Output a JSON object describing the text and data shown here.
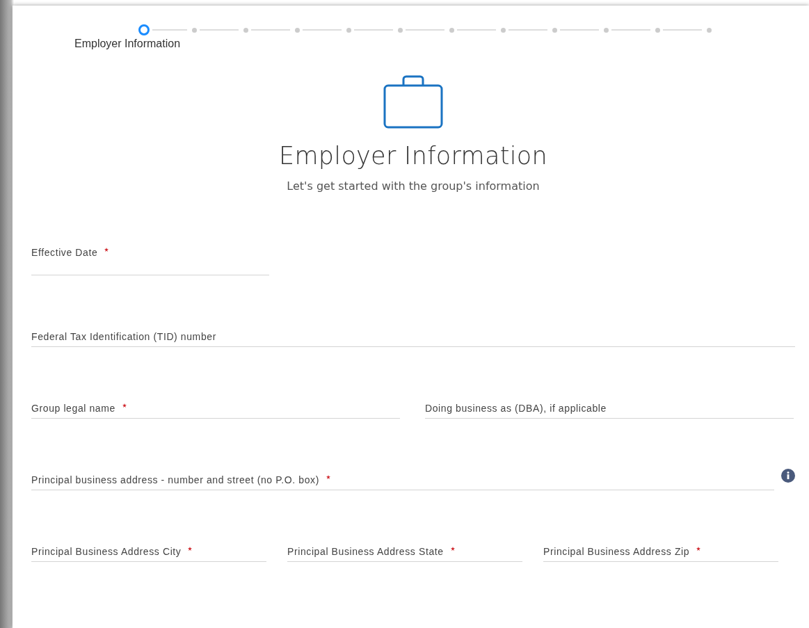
{
  "stepper": {
    "steps": [
      {
        "label": "Employer Information",
        "selected": true
      },
      {
        "selected": false
      },
      {
        "selected": false
      },
      {
        "selected": false
      },
      {
        "selected": false
      },
      {
        "selected": false
      },
      {
        "selected": false
      },
      {
        "selected": false
      },
      {
        "selected": false
      },
      {
        "selected": false
      },
      {
        "selected": false
      },
      {
        "selected": false
      }
    ]
  },
  "header": {
    "title": "Employer Information",
    "subtitle": "Let's get started with the group's information"
  },
  "form": {
    "rows": [
      {
        "fields": [
          {
            "kind": "date",
            "label": "Effective Date",
            "required": true,
            "info": false
          }
        ]
      },
      {
        "fields": [
          {
            "kind": "text",
            "label": "Federal Tax Identification (TID) number",
            "required": false,
            "info": false
          }
        ]
      },
      {
        "fields": [
          {
            "kind": "text",
            "label": "Group legal name",
            "required": true,
            "info": false
          },
          {
            "kind": "text",
            "label": "Doing business as (DBA), if applicable",
            "required": false,
            "info": false
          }
        ]
      },
      {
        "fields": [
          {
            "kind": "text",
            "label": "Principal business address - number and street (no P.O. box)",
            "required": true,
            "info": true
          }
        ]
      },
      {
        "fields": [
          {
            "kind": "text",
            "label": "Principal Business Address City",
            "required": true,
            "info": false
          },
          {
            "kind": "text",
            "label": "Principal Business Address State",
            "required": true,
            "info": false
          },
          {
            "kind": "text",
            "label": "Principal Business Address Zip",
            "required": true,
            "info": false
          }
        ]
      }
    ]
  }
}
